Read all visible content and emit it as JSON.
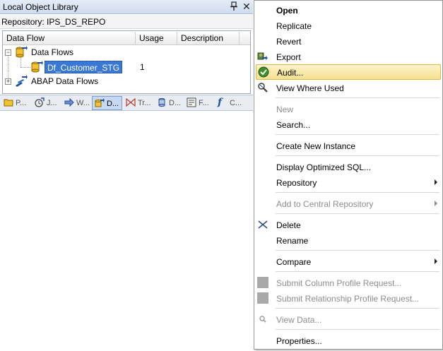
{
  "panel": {
    "title": "Local Object Library",
    "repository_line": "Repository: IPS_DS_REPO",
    "columns": [
      "Data Flow",
      "Usage",
      "Description"
    ],
    "tree": {
      "data_flows_label": "Data Flows",
      "selected_item": "Df_Customer_STG",
      "selected_usage": "1",
      "abap_label": "ABAP Data Flows"
    },
    "tabs": [
      "P...",
      "J...",
      "W...",
      "D...",
      "Tr...",
      "D...",
      "F...",
      "C..."
    ],
    "active_tab_index": 3
  },
  "menu": {
    "items": [
      {
        "label": "Open",
        "bold": true,
        "disabled": false
      },
      {
        "label": "Replicate",
        "disabled": false
      },
      {
        "label": "Revert",
        "disabled": false
      },
      {
        "label": "Export",
        "disabled": false,
        "icon": "export-icon"
      },
      {
        "label": "Audit...",
        "disabled": false,
        "icon": "audit-check-icon",
        "highlighted": true
      },
      {
        "label": "View Where Used",
        "disabled": false,
        "icon": "where-used-icon"
      },
      {
        "label": "New",
        "disabled": true
      },
      {
        "label": "Search...",
        "disabled": false
      },
      {
        "label": "Create New Instance",
        "disabled": false
      },
      {
        "label": "Display Optimized SQL...",
        "disabled": false
      },
      {
        "label": "Repository",
        "disabled": false,
        "submenu": true
      },
      {
        "label": "Add to Central Repository",
        "disabled": true,
        "submenu": true
      },
      {
        "label": "Delete",
        "disabled": false,
        "icon": "delete-icon"
      },
      {
        "label": "Rename",
        "disabled": false
      },
      {
        "label": "Compare",
        "disabled": false,
        "submenu": true
      },
      {
        "label": "Submit Column Profile Request...",
        "disabled": true,
        "icon": "profile-icon"
      },
      {
        "label": "Submit Relationship Profile Request...",
        "disabled": true,
        "icon": "profile-icon"
      },
      {
        "label": "View Data...",
        "disabled": true,
        "icon": "view-data-icon"
      },
      {
        "label": "Properties...",
        "disabled": false
      }
    ]
  },
  "colors": {
    "selection": "#3a78d6",
    "menu_highlight": "#f6e08f",
    "disabled_text": "#8d8d8d"
  }
}
